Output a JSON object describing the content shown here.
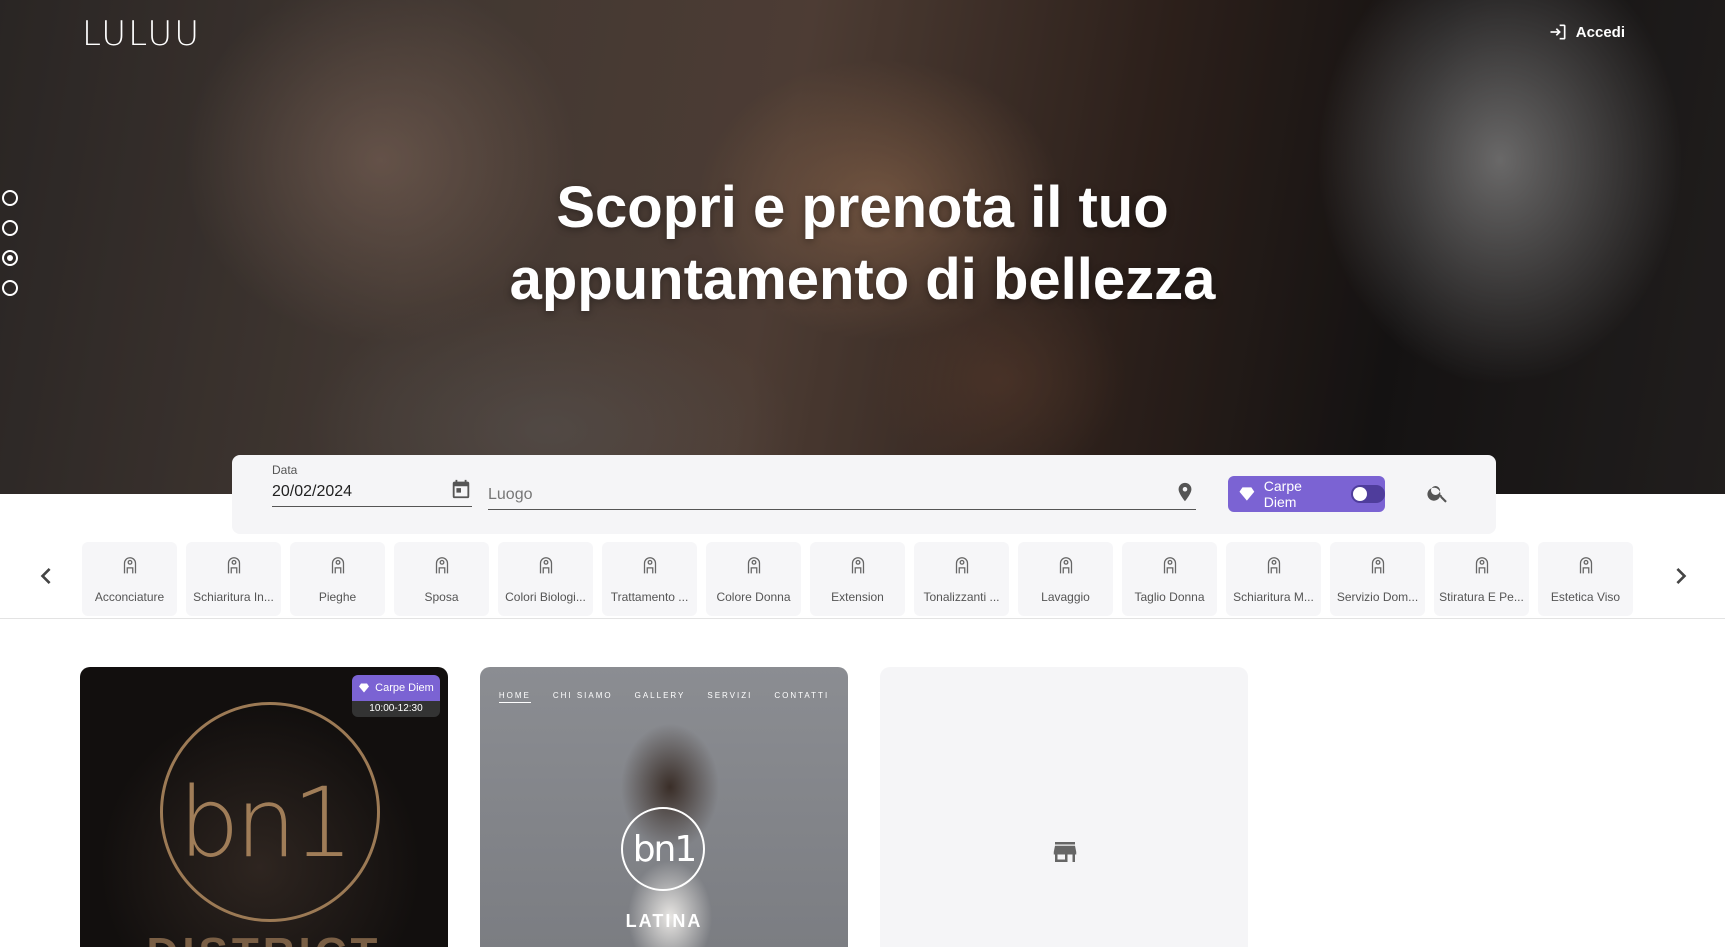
{
  "header": {
    "logo": "LULUU",
    "login_label": "Accedi"
  },
  "hero": {
    "line1": "Scopri e prenota il tuo",
    "line2": "appuntamento di bellezza",
    "slides_total": 4,
    "active_slide": 3
  },
  "search": {
    "date_label": "Data",
    "date_value": "20/02/2024",
    "place_placeholder": "Luogo",
    "carpe_label": "Carpe Diem"
  },
  "categories": [
    {
      "label": "Acconciature",
      "icon": "hair-style-icon"
    },
    {
      "label": "Schiaritura In...",
      "icon": "lightening-icon"
    },
    {
      "label": "Pieghe",
      "icon": "blowdry-icon"
    },
    {
      "label": "Sposa",
      "icon": "bride-icon"
    },
    {
      "label": "Colori Biologi...",
      "icon": "color-icon"
    },
    {
      "label": "Trattamento ...",
      "icon": "treatment-icon"
    },
    {
      "label": "Colore Donna",
      "icon": "color-woman-icon"
    },
    {
      "label": "Extension",
      "icon": "extension-icon"
    },
    {
      "label": "Tonalizzanti ...",
      "icon": "toner-icon"
    },
    {
      "label": "Lavaggio",
      "icon": "wash-icon"
    },
    {
      "label": "Taglio Donna",
      "icon": "haircut-icon"
    },
    {
      "label": "Schiaritura M...",
      "icon": "highlights-icon"
    },
    {
      "label": "Servizio Dom...",
      "icon": "home-service-icon"
    },
    {
      "label": "Stiratura E Pe...",
      "icon": "straightening-icon"
    },
    {
      "label": "Estetica Viso",
      "icon": "face-icon"
    }
  ],
  "cards": {
    "card1": {
      "logo_text": "bn1",
      "subtitle": "DISTRICT",
      "badge_label": "Carpe Diem",
      "badge_time": "10:00-12:30"
    },
    "card2": {
      "nav": [
        "HOME",
        "CHI SIAMO",
        "GALLERY",
        "SERVIZI",
        "CONTATTI"
      ],
      "logo_text": "bn1",
      "city": "LATINA"
    },
    "card3": {
      "icon": "store-icon"
    }
  },
  "colors": {
    "accent": "#7b63d3",
    "hero_text": "#ffffff"
  }
}
